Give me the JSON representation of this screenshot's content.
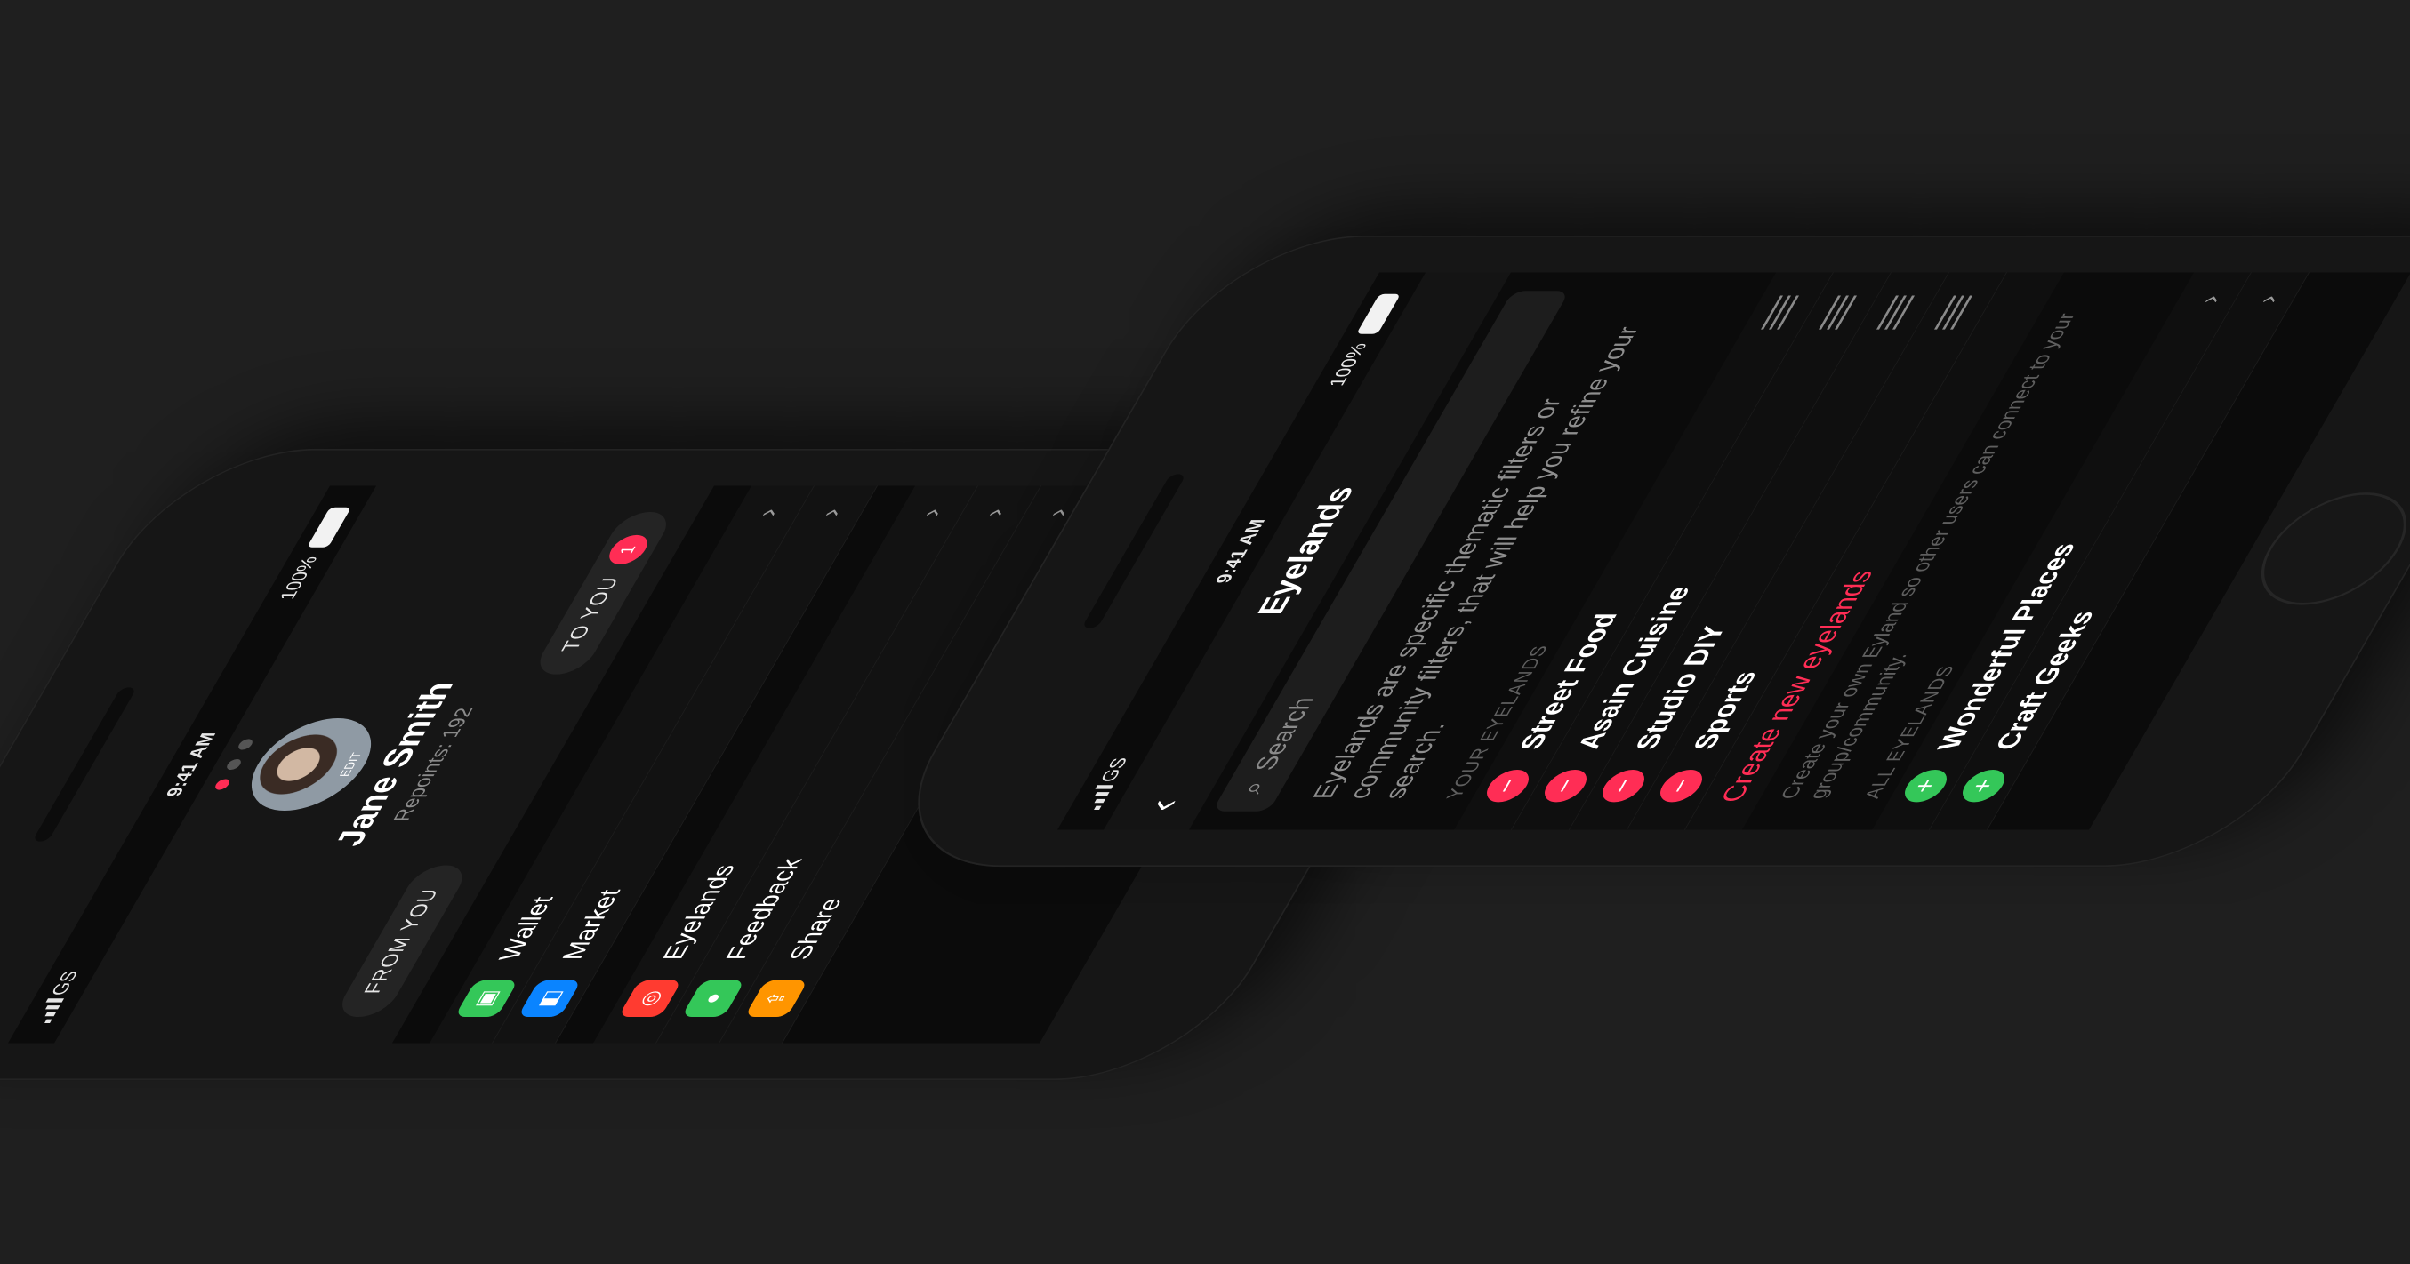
{
  "status": {
    "carrier": "GS",
    "time": "9:41 AM",
    "battery": "100%"
  },
  "profile": {
    "avatar_edit": "EDIT",
    "name": "Jane Smith",
    "repoints": "Repoints: 192",
    "page_dots": 3,
    "active_dot": 1,
    "tabs": {
      "from_you": "FROM YOU",
      "to_you": "TO YOU",
      "to_you_badge": "1"
    },
    "menu": [
      {
        "label": "Wallet",
        "icon": "wallet-icon",
        "color": "#34c759"
      },
      {
        "label": "Market",
        "icon": "market-icon",
        "color": "#0a84ff"
      },
      {
        "label": "Eyelands",
        "icon": "eyelands-icon",
        "color": "#ff3b30"
      },
      {
        "label": "Feedback",
        "icon": "feedback-icon",
        "color": "#34c759"
      },
      {
        "label": "Share",
        "icon": "share-icon",
        "color": "#ff9500"
      }
    ]
  },
  "eyelands": {
    "title": "Eyelands",
    "search_placeholder": "Search",
    "description": "Eyelands are specific thematic filters or community filters, that will help you refine your search.",
    "your_section": "YOUR EYELANDS",
    "your_items": [
      "Street Food",
      "Asain Cuisine",
      "Studio DIY",
      "Sports"
    ],
    "create_label": "Create new eyelands",
    "create_hint": "Create your own Eyland so other users can connect to your group/community.",
    "all_section": "ALL EYELANDS",
    "all_items": [
      "Wonderful Places",
      "Craft Geeks"
    ]
  },
  "colors": {
    "accent_red": "#ff2d55",
    "accent_green": "#34c759",
    "background": "#1f1f1f"
  }
}
